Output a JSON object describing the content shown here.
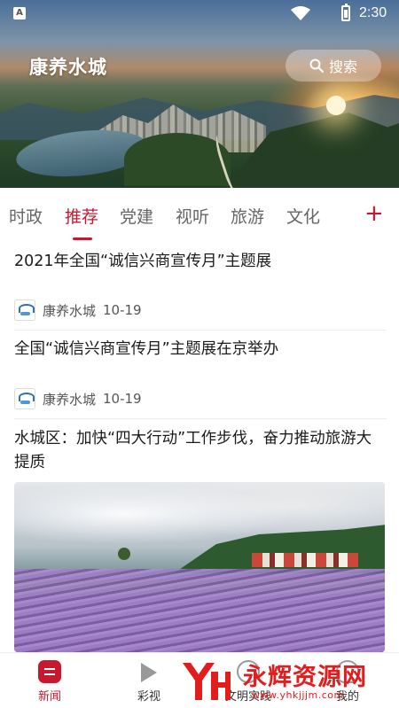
{
  "status_bar": {
    "time": "2:30",
    "notification_icon": "a-icon",
    "wifi_icon": "wifi-icon",
    "battery_icon": "battery-icon"
  },
  "header": {
    "app_title": "康养水城",
    "search_label": "搜索",
    "search_icon": "search-icon"
  },
  "tabs": {
    "items": [
      {
        "label": "时政",
        "active": false
      },
      {
        "label": "推荐",
        "active": true
      },
      {
        "label": "党建",
        "active": false
      },
      {
        "label": "视听",
        "active": false
      },
      {
        "label": "旅游",
        "active": false
      },
      {
        "label": "文化",
        "active": false
      }
    ],
    "add_label": "+",
    "accent_color": "#c8182f"
  },
  "feed": {
    "items": [
      {
        "title": "2021年全国“诚信兴商宣传月”主题展"
      },
      {
        "source": "康养水城",
        "date": "10-19",
        "title": "全国“诚信兴商宣传月”主题展在京举办"
      },
      {
        "source": "康养水城",
        "date": "10-19",
        "title": "水城区：加快“四大行动”工作步伐，奋力推动旅游大提质"
      }
    ]
  },
  "bottom_nav": {
    "items": [
      {
        "label": "新闻",
        "icon": "news-icon",
        "active": true
      },
      {
        "label": "彩视",
        "icon": "play-icon",
        "active": false
      },
      {
        "label": "文明实践",
        "icon": "civilization-icon",
        "active": false
      },
      {
        "label": "我的",
        "icon": "profile-icon",
        "active": false
      }
    ]
  },
  "watermark": {
    "logo": "YH",
    "text": "永辉资源网",
    "url": "www.yhkjjjm.com"
  }
}
